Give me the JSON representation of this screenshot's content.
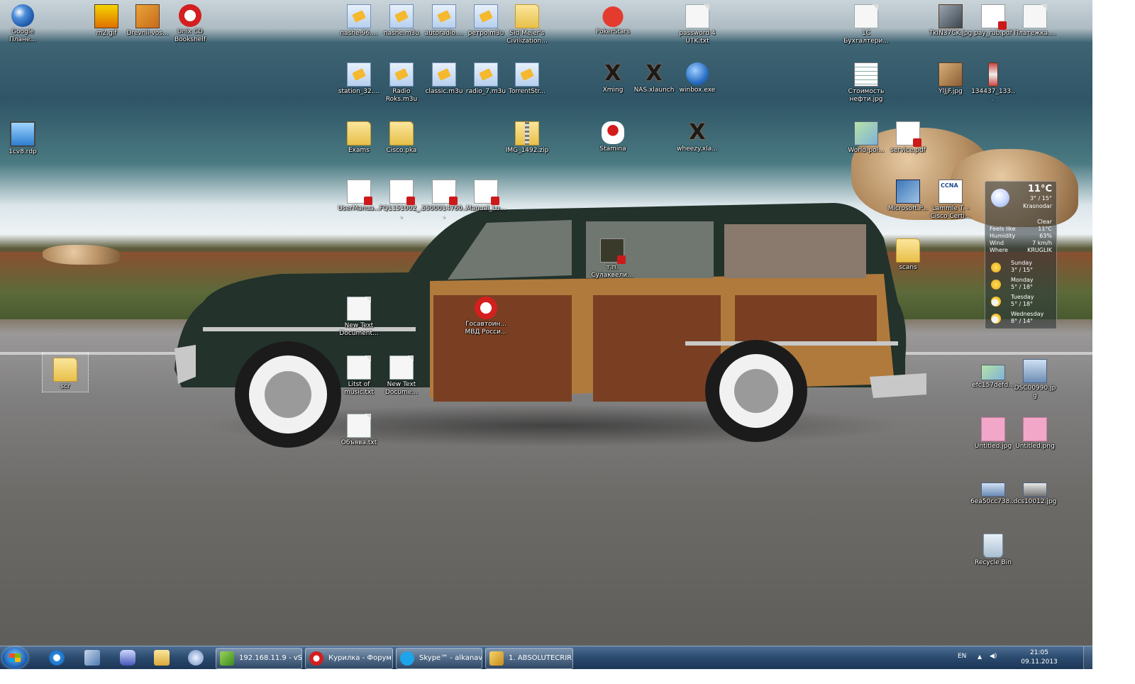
{
  "desktop_icons": {
    "google_earth": "Google Плане...",
    "m2gif": "m2.gif",
    "drevnii": "Drevnii-vos...",
    "unix_cd": "Unix CD Bookshelf",
    "nashe96": "nashe-96....",
    "nashem3u": "nashe.m3u",
    "autoradio": "autoradio....",
    "retro": "ретро.m3u",
    "sid_meier": "Sid Meier's Civilization...",
    "pokerstars": "PokerStars",
    "password4": "password 4 UTK.txt",
    "buh1c": "1С Бухгалтери...",
    "tkin37": "TkIN37CK.jpg",
    "pay_rub": "pay_rub.pdf",
    "platezhka": "Платежка....",
    "station32": "station_32....",
    "radioroks": "Radio Roks.m3u",
    "classic": "classic.m3u",
    "radio7": "radio_7.m3u",
    "torrentstr": "TorrentStr...",
    "xming": "Xming",
    "nasxlaunch": "NAS.xlaunch",
    "winbox": "winbox.exe",
    "stoimost": "Стоимость нефти.jpg",
    "yljf": "YlJjF.jpg",
    "n134437": "134437_133...",
    "rdp": "1cv8.rdp",
    "exams": "Exams",
    "ciscopka": "Cisco.pka",
    "img1492": "IMG_1492.zip",
    "stamina": "Stamina",
    "wheezy": "wheezy.xla...",
    "worldpol": "World-pol...",
    "servicepdf": "service.pdf",
    "usermanual": "UserManua...",
    "fq": "FQ1151002_...",
    "s5000": "5500014760...",
    "manual_l": "Manual_Lu...",
    "tp_sulak": "т.п. Сулаквели...",
    "microsoft_p": "Microsoft.P...",
    "lammle": "Lammle T. - Cisco Certi...",
    "scans": "scans",
    "newtext1": "New Text Document...",
    "gosavtoin": "Госавтоин... МВД Росси...",
    "scr": "scr",
    "litstmusic": "Litst of music.txt",
    "newtext2": "New Text Docume...",
    "obyava": "Объява.txt",
    "efc157": "efc157defd...",
    "dsc00990": "DSC00990.jpg",
    "untitled_jpg": "Untitled.jpg",
    "untitled_png": "Untitled.png",
    "n6ea50": "6ea50cc738...",
    "dcs10012": "dcs10012.jpg",
    "recycle": "Recycle Bin"
  },
  "weather": {
    "temp": "11°C",
    "hilo": "3° / 15°",
    "city": "Krasnodar",
    "condition": "Clear",
    "feels_label": "Feels like",
    "feels_value": "11°C",
    "humidity_label": "Humidity",
    "humidity_value": "63%",
    "wind_label": "Wind",
    "wind_value": "7 km/h",
    "where_label": "Where",
    "where_value": "KRUGLIK",
    "days": [
      {
        "name": "Sunday",
        "temps": "3° / 15°"
      },
      {
        "name": "Monday",
        "temps": "5° / 18°"
      },
      {
        "name": "Tuesday",
        "temps": "5° / 18°"
      },
      {
        "name": "Wednesday",
        "temps": "8° / 14°"
      }
    ]
  },
  "taskbar": {
    "tasks": [
      {
        "label": "192.168.11.9 - vSp..."
      },
      {
        "label": "Курилка - Форум..."
      },
      {
        "label": "Skype™ - alkanavt_"
      },
      {
        "label": "1. ABSOLUTECRIR..."
      }
    ],
    "tray": {
      "lang": "EN",
      "time": "21:05",
      "date": "09.11.2013"
    }
  },
  "colors": {
    "taskbar": "#2a4a6e",
    "car_body": "#23322b",
    "wood": "#b07a3c"
  }
}
